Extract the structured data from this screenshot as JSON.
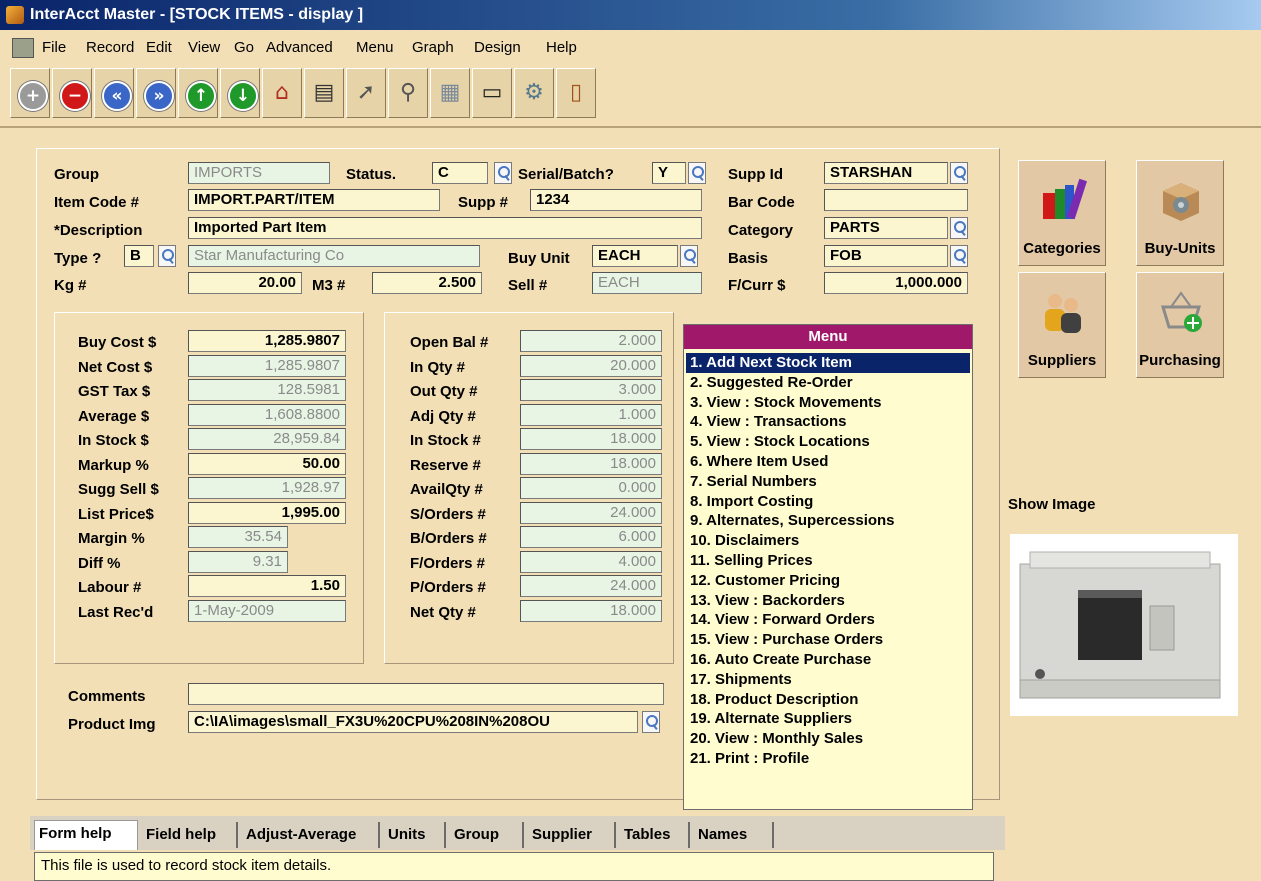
{
  "window": {
    "title": "InterAcct Master - [STOCK ITEMS - display ]"
  },
  "menubar": [
    "File",
    "Record",
    "Edit",
    "View",
    "Go",
    "Advanced",
    "Menu",
    "Graph",
    "Design",
    "Help"
  ],
  "toolbar": [
    {
      "name": "add",
      "icon": "plus-circle-icon",
      "glyph": "+",
      "color": "#9a9a9a"
    },
    {
      "name": "delete",
      "icon": "minus-circle-icon",
      "glyph": "−",
      "color": "#d01818"
    },
    {
      "name": "first",
      "icon": "rewind-icon",
      "glyph": "«",
      "color": "#3a66c8"
    },
    {
      "name": "last",
      "icon": "forward-icon",
      "glyph": "»",
      "color": "#3a66c8"
    },
    {
      "name": "up",
      "icon": "arrow-up-icon",
      "glyph": "↑",
      "color": "#1f9a2a"
    },
    {
      "name": "down",
      "icon": "arrow-down-icon",
      "glyph": "↓",
      "color": "#1f9a2a"
    },
    {
      "name": "home",
      "icon": "house-icon",
      "glyph": "⌂",
      "color": "#b03020"
    },
    {
      "name": "print",
      "icon": "printer-icon",
      "glyph": "▤",
      "color": "#333333"
    },
    {
      "name": "document",
      "icon": "document-arrow-icon",
      "glyph": "➚",
      "color": "#555555"
    },
    {
      "name": "search",
      "icon": "magnifier-icon",
      "glyph": "⚲",
      "color": "#555555"
    },
    {
      "name": "calendar",
      "icon": "calendar-icon",
      "glyph": "▦",
      "color": "#7a8a9a"
    },
    {
      "name": "monitor",
      "icon": "monitor-icon",
      "glyph": "▭",
      "color": "#222222"
    },
    {
      "name": "settings",
      "icon": "gear-icon",
      "glyph": "⚙",
      "color": "#557a8a"
    },
    {
      "name": "exit",
      "icon": "door-icon",
      "glyph": "▯",
      "color": "#a0521a"
    }
  ],
  "header": {
    "group_label": "Group",
    "group": "IMPORTS",
    "status_label": "Status.",
    "status": "C",
    "serial_label": "Serial/Batch?",
    "serial": "Y",
    "suppid_label": "Supp Id",
    "suppid": "STARSHAN",
    "itemcode_label": "Item Code #",
    "itemcode": "IMPORT.PART/ITEM",
    "suppnum_label": "Supp #",
    "suppnum": "1234",
    "barcode_label": "Bar Code",
    "barcode": "",
    "desc_label": "*Description",
    "desc": "Imported Part Item",
    "category_label": "Category",
    "category": "PARTS",
    "type_label": "Type ?",
    "type": "B",
    "supplier_name": "Star Manufacturing Co",
    "buyunit_label": "Buy Unit",
    "buyunit": "EACH",
    "basis_label": "Basis",
    "basis": "FOB",
    "kg_label": "Kg #",
    "kg": "20.00",
    "m3_label": "M3 #",
    "m3": "2.500",
    "sell_label": "Sell #",
    "sell": "EACH",
    "fcurr_label": "F/Curr $",
    "fcurr": "1,000.000"
  },
  "costs": [
    {
      "label": "Buy Cost $",
      "value": "1,285.9807",
      "editable": true
    },
    {
      "label": "Net Cost  $",
      "value": "1,285.9807",
      "editable": false
    },
    {
      "label": "GST Tax  $",
      "value": "128.5981",
      "editable": false
    },
    {
      "label": "Average  $",
      "value": "1,608.8800",
      "editable": false
    },
    {
      "label": "In Stock  $",
      "value": "28,959.84",
      "editable": false
    },
    {
      "label": "Markup %",
      "value": "50.00",
      "editable": true
    },
    {
      "label": "Sugg Sell $",
      "value": "1,928.97",
      "editable": false
    },
    {
      "label": "List Price$",
      "value": "1,995.00",
      "editable": true
    },
    {
      "label": "Margin %",
      "value": "35.54",
      "editable": false
    },
    {
      "label": "Diff %",
      "value": "9.31",
      "editable": false
    },
    {
      "label": "Labour #",
      "value": "1.50",
      "editable": true
    },
    {
      "label": "Last Rec'd",
      "value": "1-May-2009",
      "editable": false
    }
  ],
  "quantities": [
    {
      "label": "Open Bal #",
      "value": "2.000"
    },
    {
      "label": "In  Qty  #",
      "value": "20.000"
    },
    {
      "label": "Out Qty  #",
      "value": "3.000"
    },
    {
      "label": "Adj Qty  #",
      "value": "1.000"
    },
    {
      "label": "In Stock #",
      "value": "18.000"
    },
    {
      "label": "Reserve  #",
      "value": "18.000"
    },
    {
      "label": "AvailQty #",
      "value": "0.000"
    },
    {
      "label": "S/Orders #",
      "value": "24.000"
    },
    {
      "label": "B/Orders #",
      "value": "6.000"
    },
    {
      "label": "F/Orders #",
      "value": "4.000"
    },
    {
      "label": "P/Orders #",
      "value": "24.000"
    },
    {
      "label": "Net Qty  #",
      "value": "18.000"
    }
  ],
  "comments": {
    "comments_label": "Comments",
    "comments": "",
    "img_label": "Product Img",
    "img": "C:\\IA\\images\\small_FX3U%20CPU%208IN%208OU"
  },
  "menu": {
    "title": "Menu",
    "items": [
      "1. Add Next Stock Item",
      "2. Suggested Re-Order",
      "3. View : Stock Movements",
      "4. View : Transactions",
      "5. View : Stock Locations",
      "6. Where Item Used",
      "7. Serial Numbers",
      "8. Import Costing",
      "9. Alternates, Supercessions",
      "10. Disclaimers",
      "11. Selling Prices",
      "12. Customer Pricing",
      "13. View : Backorders",
      "14. View : Forward Orders",
      "15. View : Purchase Orders",
      "16. Auto Create Purchase",
      "17. Shipments",
      "18. Product Description",
      "19. Alternate Suppliers",
      "20. View : Monthly Sales",
      "21. Print : Profile"
    ]
  },
  "side_buttons": [
    {
      "label": "Categories",
      "icon": "books-icon"
    },
    {
      "label": "Buy-Units",
      "icon": "box-gear-icon"
    },
    {
      "label": "Suppliers",
      "icon": "people-icon"
    },
    {
      "label": "Purchasing",
      "icon": "basket-add-icon"
    }
  ],
  "show_image_label": "Show Image",
  "tabs": [
    "Form help",
    "Field help",
    "Adjust-Average",
    "Units",
    "Group",
    "Supplier",
    "Tables",
    "Names"
  ],
  "help_text": "This file is used to record stock item details."
}
